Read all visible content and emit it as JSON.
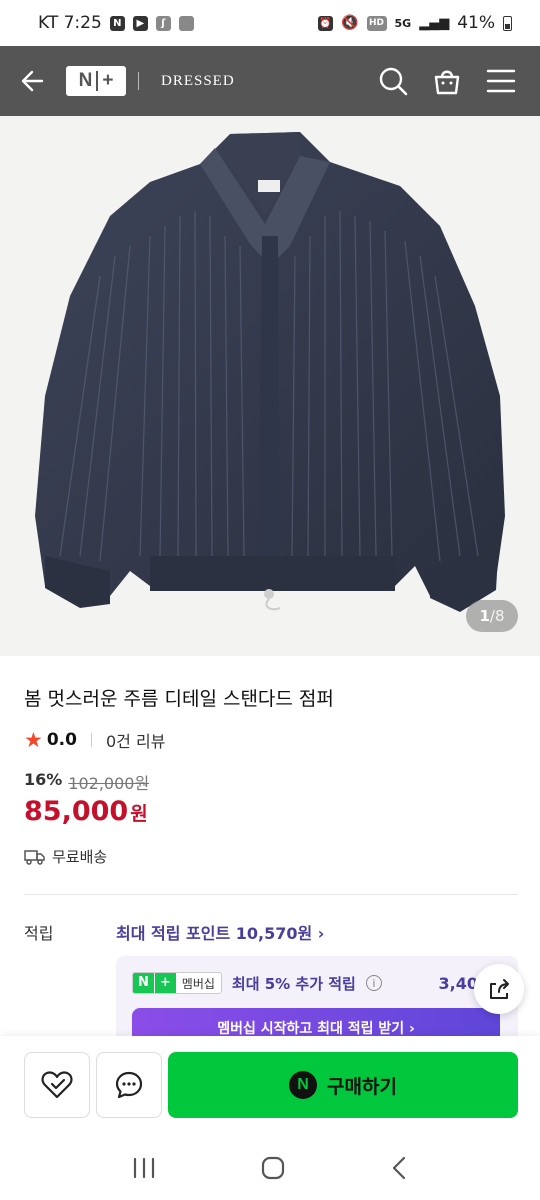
{
  "status_bar": {
    "carrier_time": "KT 7:25",
    "icons_left": [
      "N",
      "▶",
      "♁",
      "app"
    ],
    "network": "5G",
    "battery": "41%"
  },
  "header": {
    "logo": "N+",
    "brand": "DRESSED"
  },
  "product": {
    "image_counter_current": "1",
    "image_counter_total": "/8",
    "title": "봄 멋스러운 주름 디테일 스탠다드 점퍼",
    "rating": "0.0",
    "reviews": "0건 리뷰",
    "discount_rate": "16%",
    "original_price": "102,000원",
    "price": "85,000",
    "price_unit": "원",
    "shipping": "무료배송"
  },
  "points": {
    "label": "적립",
    "link": "최대 적립 포인트 10,570원 ›"
  },
  "membership": {
    "badge_n": "N",
    "badge_plus": "+",
    "badge_text": "멤버십",
    "text": "최대 5% 추가 적립",
    "info": "i",
    "amount": "3,40",
    "cta": "멤버십 시작하고 최대 적립 받기 ›"
  },
  "bottom": {
    "buy_label": "구매하기",
    "npay": "N"
  },
  "colors": {
    "header": "#555555",
    "price": "#c4102b",
    "buy_button": "#00c73c",
    "membership_text": "#4b3d9c"
  }
}
